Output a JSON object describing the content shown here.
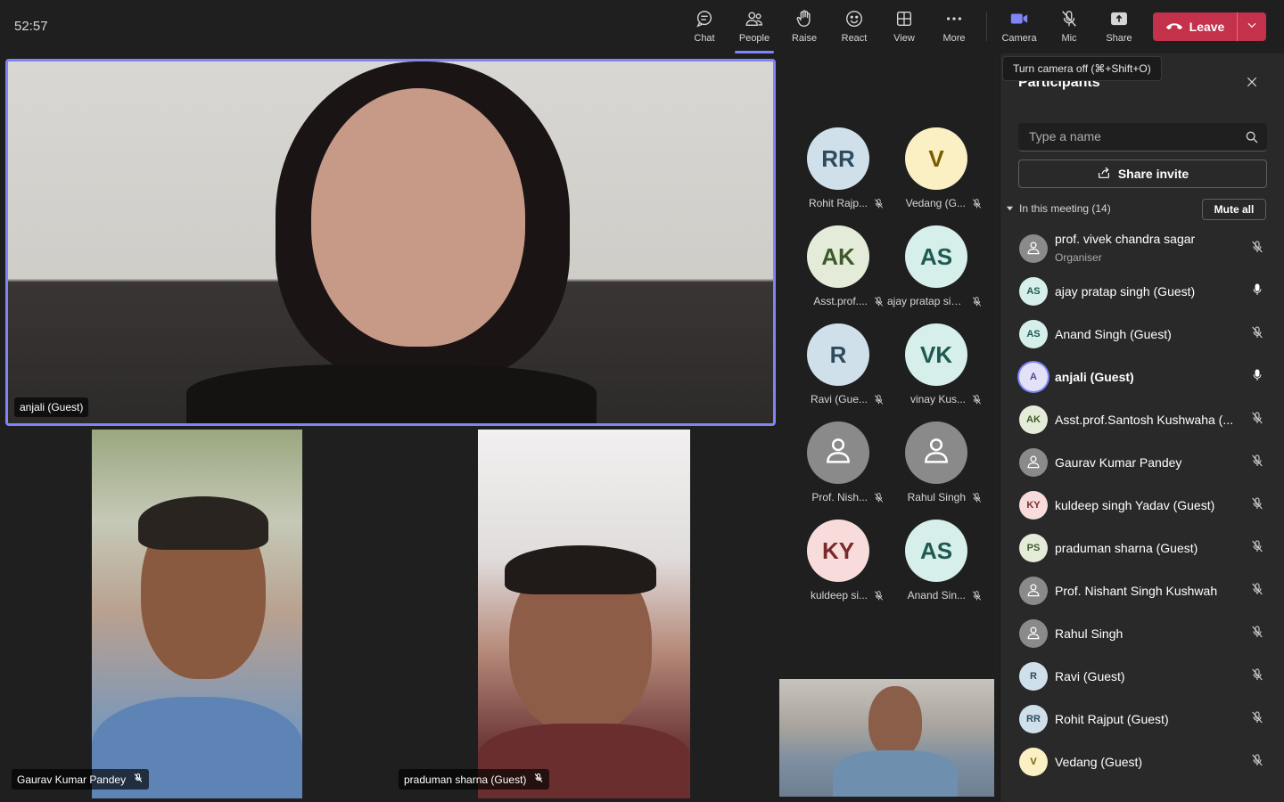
{
  "timer": "52:57",
  "toolbar": {
    "chat": "Chat",
    "people": "People",
    "raise": "Raise",
    "react": "React",
    "view": "View",
    "more": "More",
    "camera": "Camera",
    "mic": "Mic",
    "share": "Share",
    "leave": "Leave"
  },
  "tooltip": "Turn camera off (⌘+Shift+O)",
  "stage": {
    "main_tile_name": "anjali (Guest)",
    "tile2_name": "Gaurav Kumar Pandey",
    "tile3_name": "praduman sharna (Guest)",
    "avatars": [
      {
        "initials": "RR",
        "name": "Rohit Rajp...",
        "bg": "#d0e0ea",
        "fg": "#2e4a5e"
      },
      {
        "initials": "V",
        "name": "Vedang (G...",
        "bg": "#fbf0c4",
        "fg": "#7a5a00"
      },
      {
        "initials": "AK",
        "name": "Asst.prof....",
        "bg": "#e4ecd9",
        "fg": "#3e5a2a"
      },
      {
        "initials": "AS",
        "name": "ajay pratap sin...",
        "bg": "#d6efea",
        "fg": "#1f5a52"
      },
      {
        "initials": "R",
        "name": "Ravi (Gue...",
        "bg": "#d0e0ea",
        "fg": "#2e4a5e"
      },
      {
        "initials": "VK",
        "name": "vinay Kus...",
        "bg": "#d6efea",
        "fg": "#1f5a52"
      },
      {
        "initials": "",
        "name": "Prof. Nish...",
        "bg": "#8a8a8a",
        "fg": "#ffffff"
      },
      {
        "initials": "",
        "name": "Rahul Singh",
        "bg": "#8a8a8a",
        "fg": "#ffffff"
      },
      {
        "initials": "KY",
        "name": "kuldeep si...",
        "bg": "#f8dcdc",
        "fg": "#7a2a2a"
      },
      {
        "initials": "AS",
        "name": "Anand Sin...",
        "bg": "#d6efea",
        "fg": "#1f5a52"
      }
    ]
  },
  "panel": {
    "title": "Participants",
    "search_placeholder": "Type a name",
    "share_invite": "Share invite",
    "section_label": "In this meeting (14)",
    "mute_all": "Mute all",
    "participants": [
      {
        "initials": "",
        "name": "prof. vivek chandra sagar",
        "role": "Organiser",
        "mic": "muted",
        "bg": "#8a8a8a",
        "fg": "#ffffff"
      },
      {
        "initials": "AS",
        "name": "ajay pratap singh (Guest)",
        "mic": "on",
        "bg": "#d6efea",
        "fg": "#1f5a52"
      },
      {
        "initials": "AS",
        "name": "Anand Singh (Guest)",
        "mic": "muted",
        "bg": "#d6efea",
        "fg": "#1f5a52"
      },
      {
        "initials": "A",
        "name": "anjali (Guest)",
        "mic": "on",
        "bold": true,
        "speaking": true,
        "bg": "#e2e1f5",
        "fg": "#4a4a9a"
      },
      {
        "initials": "AK",
        "name": "Asst.prof.Santosh Kushwaha (...",
        "mic": "muted",
        "bg": "#e4ecd9",
        "fg": "#3e5a2a"
      },
      {
        "initials": "",
        "name": "Gaurav Kumar Pandey",
        "mic": "muted",
        "bg": "#8a8a8a",
        "fg": "#ffffff"
      },
      {
        "initials": "KY",
        "name": "kuldeep singh Yadav (Guest)",
        "mic": "muted",
        "bg": "#f8dcdc",
        "fg": "#7a2a2a"
      },
      {
        "initials": "PS",
        "name": "praduman sharna (Guest)",
        "mic": "muted",
        "bg": "#e4ecd9",
        "fg": "#3e5a2a"
      },
      {
        "initials": "",
        "name": "Prof. Nishant Singh Kushwah",
        "mic": "muted",
        "bg": "#8a8a8a",
        "fg": "#ffffff"
      },
      {
        "initials": "",
        "name": "Rahul Singh",
        "mic": "muted",
        "bg": "#8a8a8a",
        "fg": "#ffffff"
      },
      {
        "initials": "R",
        "name": "Ravi (Guest)",
        "mic": "muted",
        "bg": "#d0e0ea",
        "fg": "#2e4a5e"
      },
      {
        "initials": "RR",
        "name": "Rohit Rajput (Guest)",
        "mic": "muted",
        "bg": "#d0e0ea",
        "fg": "#2e4a5e"
      },
      {
        "initials": "V",
        "name": "Vedang (Guest)",
        "mic": "muted",
        "bg": "#fbf0c4",
        "fg": "#7a5a00"
      }
    ]
  },
  "colors": {
    "accent": "#7f85f5",
    "leave": "#c4314b",
    "background": "#1f1f1f",
    "panel": "#292929"
  }
}
